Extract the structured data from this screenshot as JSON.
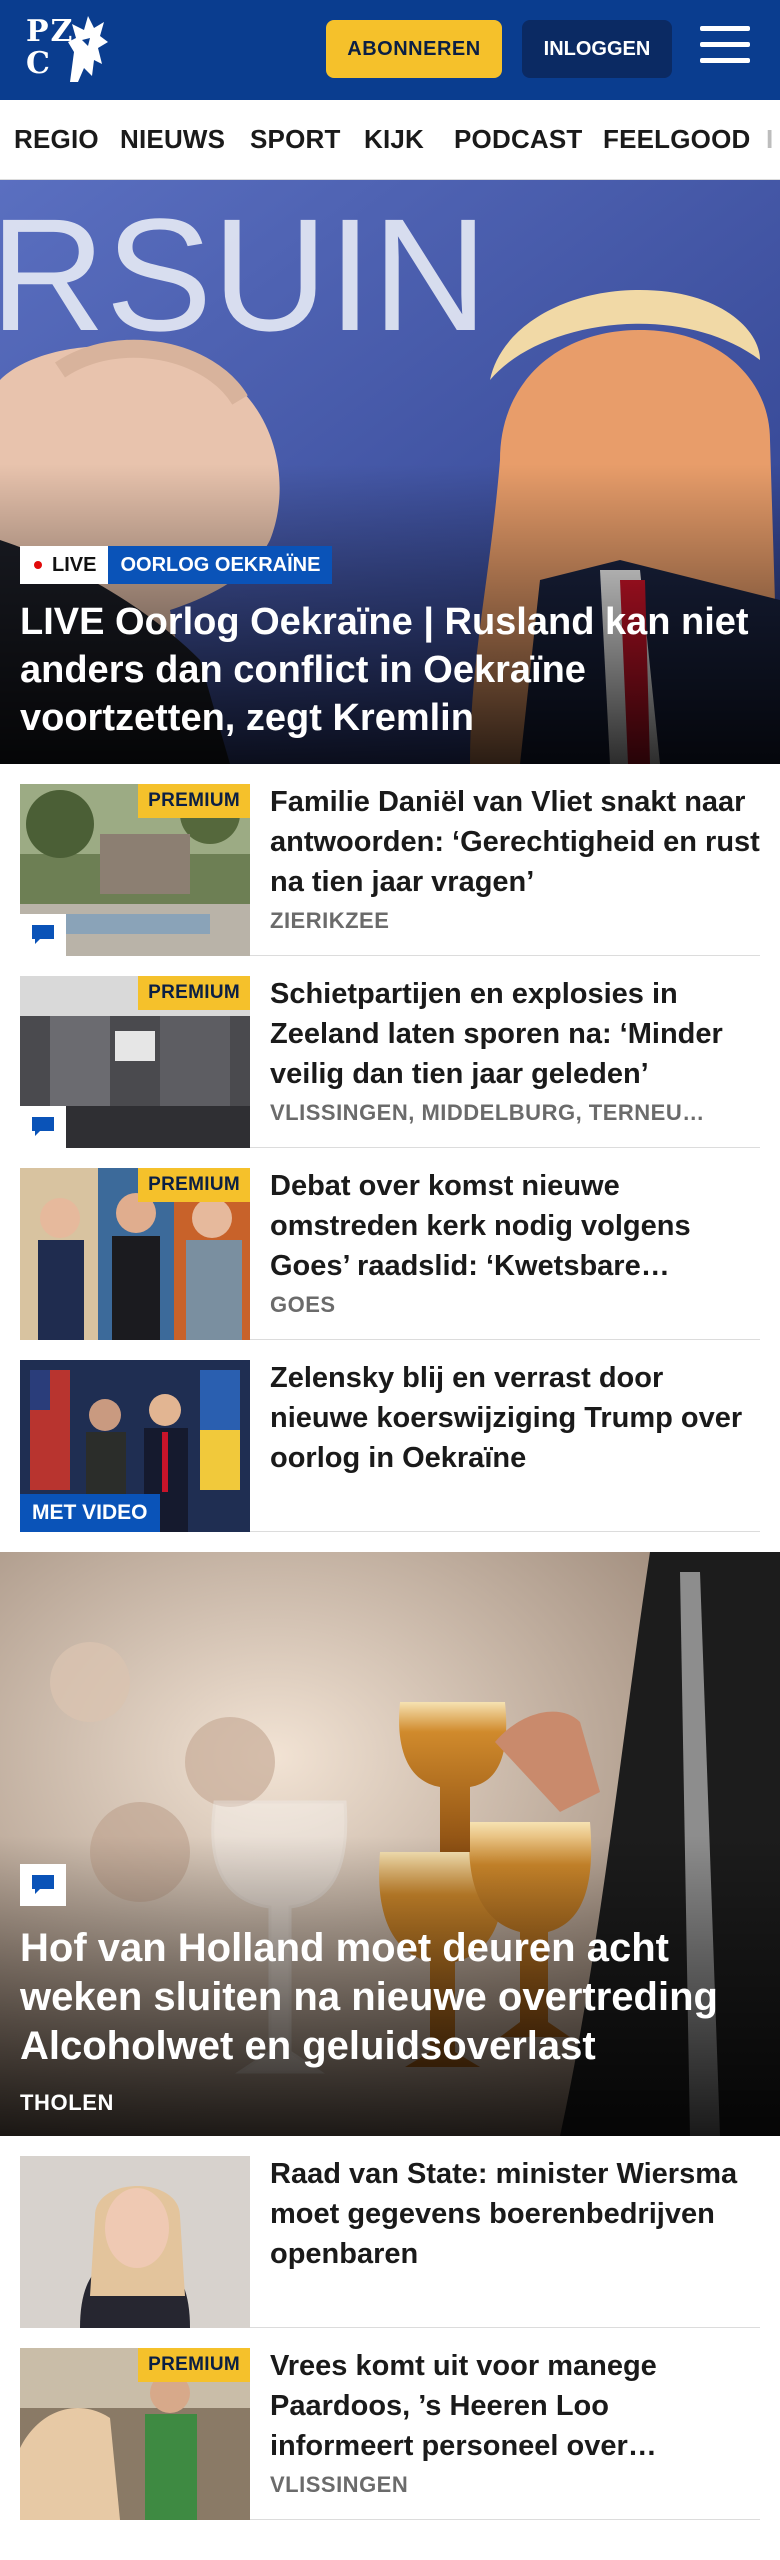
{
  "header": {
    "logo_line1": "PZ",
    "logo_line2": "C",
    "subscribe_label": "ABONNEREN",
    "login_label": "INLOGGEN",
    "brand_color": "#0a3d8f",
    "accent_color": "#f5c12b"
  },
  "nav": {
    "items": [
      {
        "label": "REGIO"
      },
      {
        "label": "NIEUWS"
      },
      {
        "label": "SPORT"
      },
      {
        "label": "KIJK"
      },
      {
        "label": "PODCAST"
      },
      {
        "label": "FEELGOOD"
      }
    ]
  },
  "hero": {
    "live_label": "LIVE",
    "topic_label": "OORLOG OEKRAÏNE",
    "title": "LIVE Oorlog Oekraïne | Rusland kan niet anders dan conflict in Oekraïne voortzetten, zegt Kremlin",
    "backdrop_text": "RSUIN"
  },
  "articles": [
    {
      "badge": "PREMIUM",
      "title": "Familie Daniël van Vliet snakt naar antwoorden: ‘Gerechtigheid en rust na tien jaar vragen’",
      "location": "ZIERIKZEE",
      "icon": "comment-icon"
    },
    {
      "badge": "PREMIUM",
      "title": "Schietpartijen en explosies in Zeeland laten sporen na: ‘Minder veilig dan tien jaar geleden’",
      "location": "VLISSINGEN, MIDDELBURG, TERNEU…",
      "icon": "comment-icon"
    },
    {
      "badge": "PREMIUM",
      "title": "Debat over komst nieuwe omstreden kerk nodig volgens Goes’ raadslid: ‘Kwetsbare…",
      "location": "GOES"
    },
    {
      "video_label": "MET VIDEO",
      "title": "Zelensky blij en verrast door nieuwe koerswijziging Trump over oorlog in Oekraïne"
    }
  ],
  "feature": {
    "title": "Hof van Holland moet deuren acht weken sluiten na nieuwe overtreding Alcoholwet en geluidsoverlast",
    "location": "THOLEN",
    "icon": "comment-icon"
  },
  "articles2": [
    {
      "title": "Raad van State: minister Wiersma moet gegevens boerenbedrijven openbaren"
    },
    {
      "badge": "PREMIUM",
      "title": "Vrees komt uit voor manege Paardoos, ’s Heeren Loo informeert personeel over…",
      "location": "VLISSINGEN"
    }
  ]
}
